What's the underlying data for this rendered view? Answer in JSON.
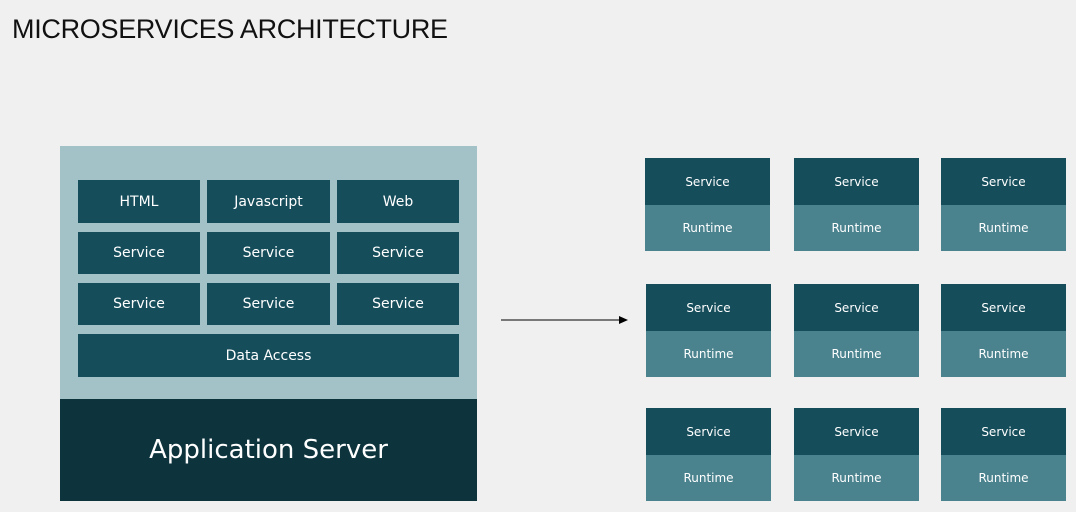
{
  "title": "MICROSERVICES ARCHITECTURE",
  "monolith": {
    "row1": [
      "HTML",
      "Javascript",
      "Web"
    ],
    "row2": [
      "Service",
      "Service",
      "Service"
    ],
    "row3": [
      "Service",
      "Service",
      "Service"
    ],
    "data_access": "Data Access",
    "app_server": "Application Server"
  },
  "microservices": [
    [
      {
        "service": "Service",
        "runtime": "Runtime"
      },
      {
        "service": "Service",
        "runtime": "Runtime"
      },
      {
        "service": "Service",
        "runtime": "Runtime"
      }
    ],
    [
      {
        "service": "Service",
        "runtime": "Runtime"
      },
      {
        "service": "Service",
        "runtime": "Runtime"
      },
      {
        "service": "Service",
        "runtime": "Runtime"
      }
    ],
    [
      {
        "service": "Service",
        "runtime": "Runtime"
      },
      {
        "service": "Service",
        "runtime": "Runtime"
      },
      {
        "service": "Service",
        "runtime": "Runtime"
      }
    ]
  ],
  "colors": {
    "background": "#f0f0f0",
    "monolith_panel": "#a2c2c7",
    "dark_teal": "#164d5b",
    "app_server": "#0d333c",
    "runtime": "#4a828e"
  }
}
